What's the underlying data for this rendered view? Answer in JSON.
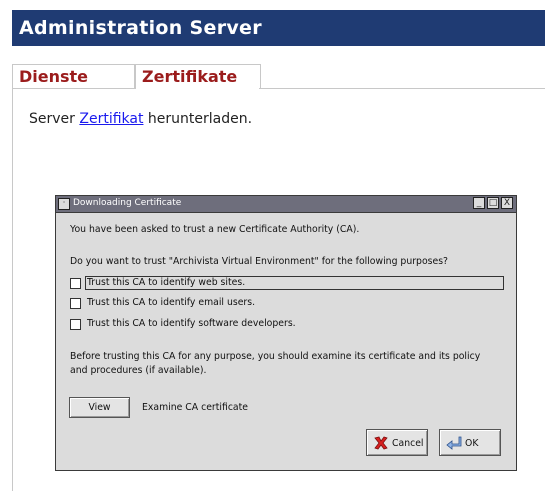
{
  "header": {
    "title": "Administration Server"
  },
  "tabs": [
    {
      "label": "Dienste"
    },
    {
      "label": "Zertifikate"
    }
  ],
  "content": {
    "prefix": "Server ",
    "link": "Zertifikat",
    "suffix": " herunterladen."
  },
  "dialog": {
    "title": "Downloading Certificate",
    "menu_glyph": "·",
    "window_buttons": {
      "minimize": "_",
      "maximize": "□",
      "close": "X"
    },
    "intro": "You have been asked to trust a new Certificate Authority (CA).",
    "question": "Do you want to trust \"Archivista Virtual Environment\" for the following purposes?",
    "options": [
      {
        "label": "Trust this CA to identify web sites.",
        "checked": false
      },
      {
        "label": "Trust this CA to identify email users.",
        "checked": false
      },
      {
        "label": "Trust this CA to identify software developers.",
        "checked": false
      }
    ],
    "note_line1": "Before trusting this CA for any purpose, you should examine its certificate and its policy",
    "note_line2": "and procedures (if available).",
    "view_button": "View",
    "view_caption": "Examine CA certificate",
    "cancel_button": "Cancel",
    "ok_button": "OK"
  },
  "colors": {
    "header_bg": "#1f3b73",
    "tab_text": "#9b1c1c",
    "link": "#1a1aee",
    "dialog_bg": "#dcdcdc"
  }
}
